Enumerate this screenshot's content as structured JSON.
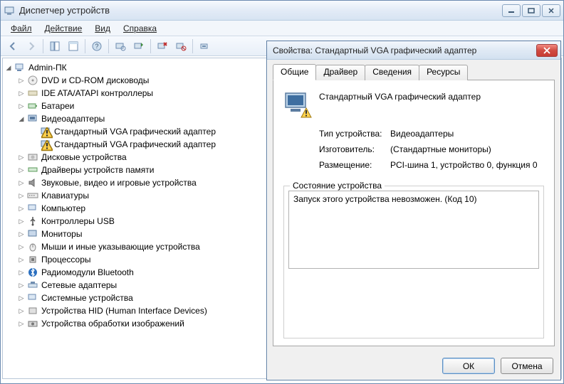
{
  "window": {
    "title": "Диспетчер устройств"
  },
  "menu": {
    "file": "Файл",
    "action": "Действие",
    "view": "Вид",
    "help": "Справка"
  },
  "tree": {
    "root": "Admin-ПК",
    "items": {
      "dvd": "DVD и CD-ROM дисководы",
      "ide": "IDE ATA/ATAPI контроллеры",
      "battery": "Батареи",
      "video": "Видеоадаптеры",
      "video_child1": "Стандартный VGA графический адаптер",
      "video_child2": "Стандартный VGA графический адаптер",
      "disk": "Дисковые устройства",
      "memory": "Драйверы устройств памяти",
      "sound": "Звуковые, видео и игровые устройства",
      "keyboard": "Клавиатуры",
      "computer": "Компьютер",
      "usb": "Контроллеры USB",
      "monitor": "Мониторы",
      "mouse": "Мыши и иные указывающие устройства",
      "cpu": "Процессоры",
      "bluetooth": "Радиомодули Bluetooth",
      "network": "Сетевые адаптеры",
      "system": "Системные устройства",
      "hid": "Устройства HID (Human Interface Devices)",
      "imaging": "Устройства обработки изображений"
    }
  },
  "dialog": {
    "title": "Свойства: Стандартный VGA графический адаптер",
    "tabs": {
      "general": "Общие",
      "driver": "Драйвер",
      "details": "Сведения",
      "resources": "Ресурсы"
    },
    "device_name": "Стандартный VGA графический адаптер",
    "rows": {
      "type_k": "Тип устройства:",
      "type_v": "Видеоадаптеры",
      "mfg_k": "Изготовитель:",
      "mfg_v": "(Стандартные мониторы)",
      "loc_k": "Размещение:",
      "loc_v": "PCI-шина 1, устройство 0, функция 0"
    },
    "status_label": "Состояние устройства",
    "status_text": "Запуск этого устройства невозможен. (Код 10)",
    "ok": "ОК",
    "cancel": "Отмена"
  }
}
